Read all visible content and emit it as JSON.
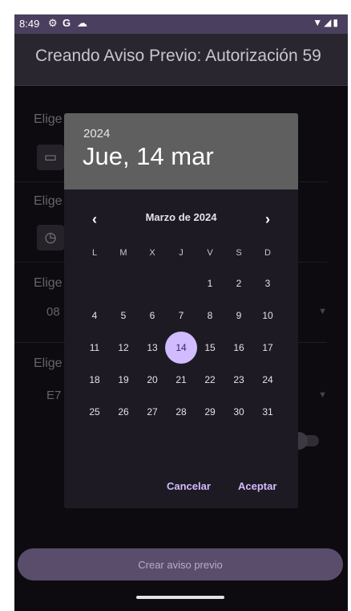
{
  "status_bar": {
    "time": "8:49",
    "icons": [
      "settings-icon",
      "google-icon",
      "cloud-icon"
    ],
    "right_icons": [
      "wifi-icon",
      "signal-icon",
      "battery-icon"
    ]
  },
  "app_bar": {
    "title": "Creando Aviso Previo: Autorización 59"
  },
  "form": {
    "row1_label": "Elige",
    "row2_label": "Elige",
    "row3_label": "Elige",
    "row3_value": "08",
    "row4_label": "Elige",
    "row4_value": "E7"
  },
  "date_picker": {
    "year": "2024",
    "selected_date": "Jue, 14 mar",
    "month_label": "Marzo de 2024",
    "prev_glyph": "‹",
    "next_glyph": "›",
    "weekdays": [
      "L",
      "M",
      "X",
      "J",
      "V",
      "S",
      "D"
    ],
    "first_weekday_index": 4,
    "days_in_month": 31,
    "selected_day": 14,
    "cancel_label": "Cancelar",
    "accept_label": "Aceptar",
    "accent_color": "#d0bcff"
  },
  "bottom_button": {
    "label": "Crear aviso previo"
  }
}
